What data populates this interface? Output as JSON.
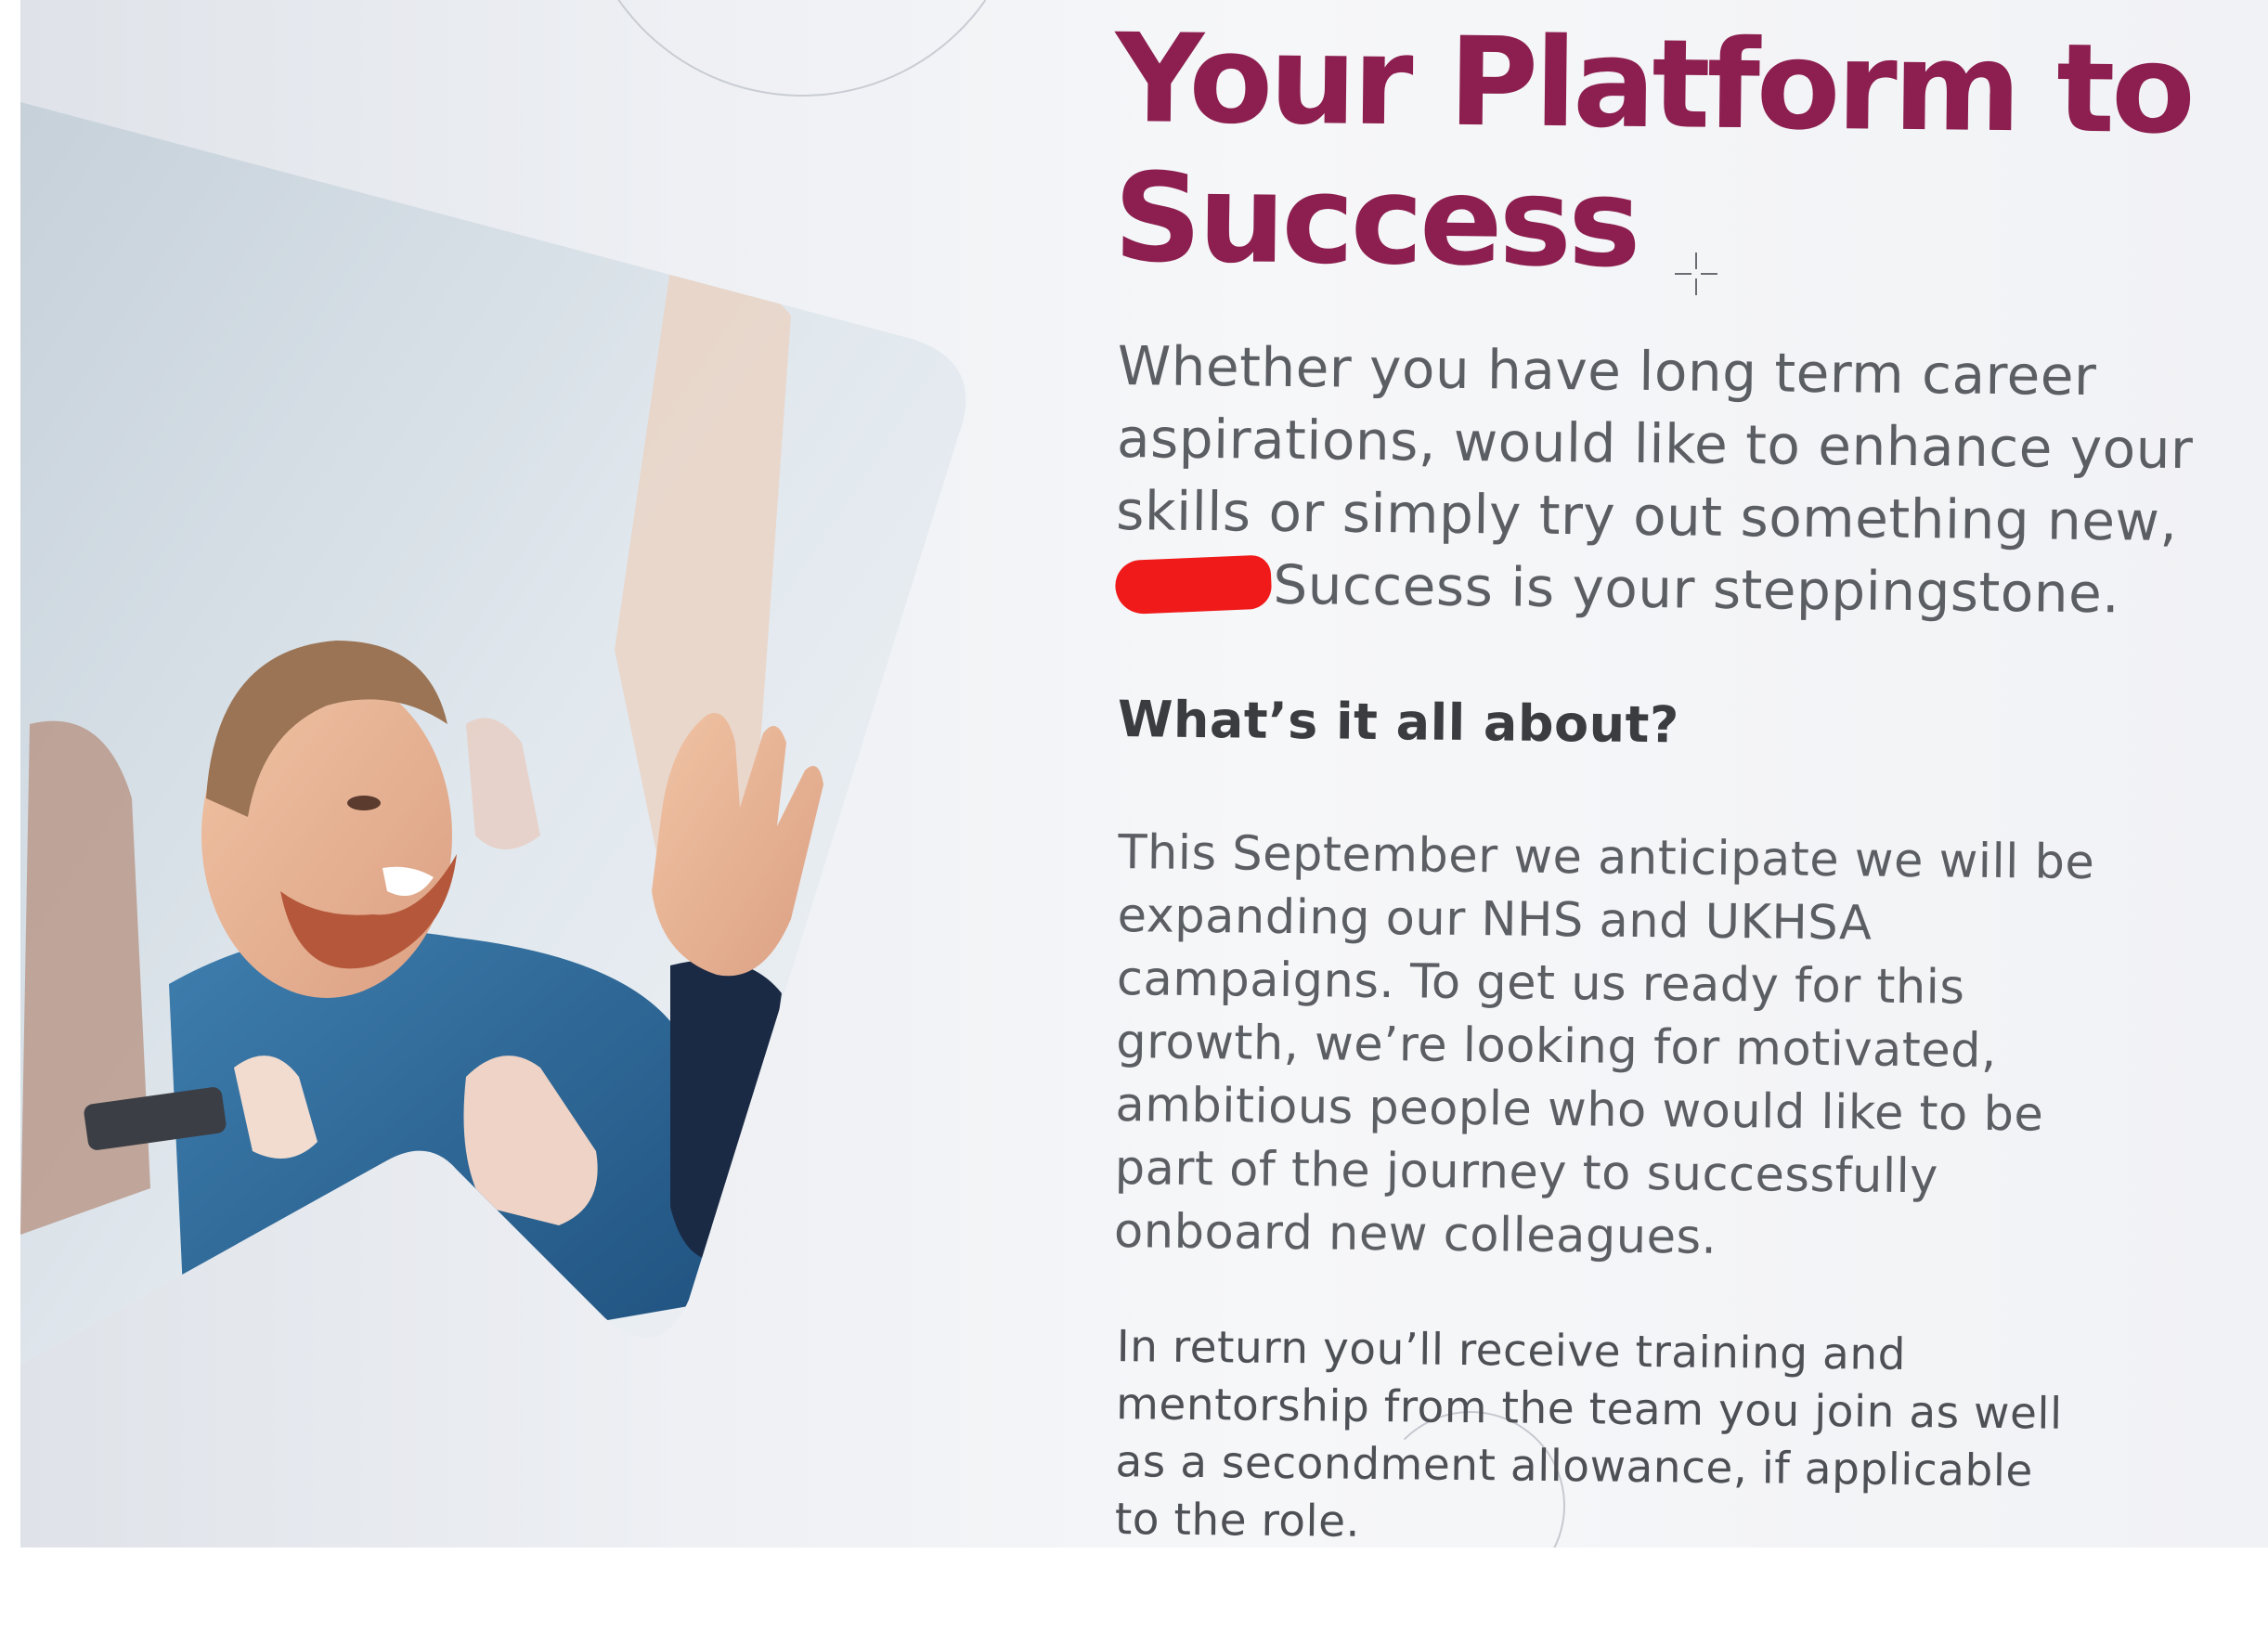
{
  "headline": {
    "line1": "Your Platform to",
    "line2": "Success"
  },
  "intro": {
    "line1": "Whether you have long term career",
    "line2": "aspirations, would like to enhance your",
    "line3": "skills or simply try out something new,",
    "line4": "Success is your steppingstone."
  },
  "section": {
    "heading": "What’s it all about?",
    "paragraph1": [
      "This September we anticipate we will be",
      "expanding our NHS and UKHSA",
      "campaigns. To get us ready for this",
      "growth, we’re looking for motivated,",
      "ambitious people who would like to be",
      "part of the journey to successfully",
      "onboard new colleagues."
    ],
    "paragraph2": [
      "In return you’ll receive training and",
      "mentorship from the team you join as well",
      "as a secondment allowance, if applicable",
      "to the role."
    ]
  },
  "icons": {
    "cursor": "crosshair-cursor-icon",
    "photo": "celebrating-man-photo"
  },
  "colors": {
    "headline": "#8c1f4f",
    "body_text": "#5b5e63",
    "heading_text": "#3a3c40",
    "redaction": "#f01a1a"
  }
}
